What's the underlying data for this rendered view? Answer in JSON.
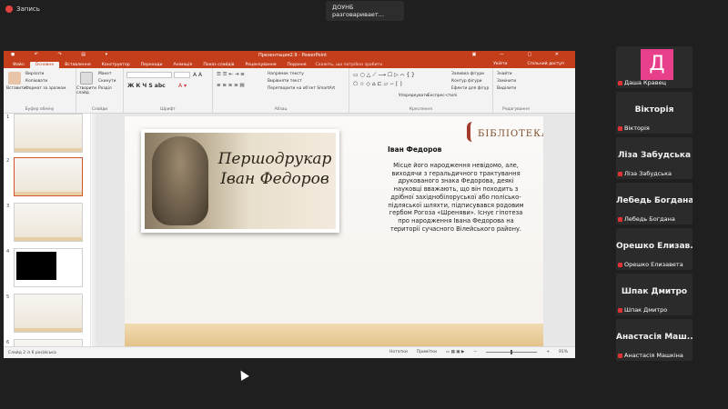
{
  "recording": {
    "label": "Запись"
  },
  "speaker": {
    "text": "ДОУНБ разговаривает..."
  },
  "ppt": {
    "title": "Презентация2.9 - PowerPoint",
    "tabs": [
      "Файл",
      "Основне",
      "Вставлення",
      "Конструктор",
      "Переходи",
      "Анімація",
      "Показ слайдів",
      "Рецензування",
      "Подання"
    ],
    "active_tab": "Основне",
    "search": "Скажіть, що потрібно зробити",
    "signin": "Увійти",
    "share": "Спільний доступ",
    "groups": {
      "clipboard": "Буфер обміну",
      "slides": "Слайди",
      "font": "Шрифт",
      "paragraph": "Абзац",
      "drawing": "Креслення",
      "editing": "Редагування"
    },
    "buttons": {
      "paste": "Вставити",
      "cut": "Вирізати",
      "copy": "Копіювати",
      "format": "Формат за зразком",
      "new_slide": "Створити слайд",
      "layout": "Макет",
      "reset": "Скинути",
      "section": "Розділ",
      "text_dir": "Напрямок тексту",
      "align_text": "Вирівняти текст",
      "smartart": "Перетворити на об'єкт SmartArt",
      "arrange": "Упорядкувати",
      "quick_styles": "Експрес-стилі",
      "fill": "Заливка фігури",
      "outline": "Контур фігури",
      "effects": "Ефекти для фігур",
      "find": "Знайти",
      "replace": "Замінити",
      "select": "Виділити"
    },
    "status": {
      "left": "Слайд 2 із 6   російська",
      "notes": "Нотатки",
      "comments": "Примітки",
      "zoom": "91%"
    },
    "slide": {
      "title_script": "Першодрукар Іван Федоров",
      "library": "БІБЛІОТЕКА",
      "name": "Іван Федоров",
      "body": "Місце його народження невідомо, але, виходячи з геральдичного трактування друкованого знака Федорова, деякі науковці вважають, що він походить з дрібної західнобілоруської або полісько-підляської шляхти, підписувався родовим гербом Рогоза «Шреняви». Існує гіпотеза про народження Івана Федорова на території сучасного Вілейського району."
    }
  },
  "participants": [
    {
      "name": "",
      "label": "Даша Кравец",
      "avatar": "Д"
    },
    {
      "name": "Вікторія",
      "label": "Вікторія"
    },
    {
      "name": "Ліза Забудська",
      "label": "Ліза Забудська"
    },
    {
      "name": "Лебедь Богдана",
      "label": "Лебедь Богдана"
    },
    {
      "name": "Орешко Елизав...",
      "label": "Орешко Елизавета"
    },
    {
      "name": "Шпак Дмитро",
      "label": "Шпак Дмитро"
    },
    {
      "name": "Анастасія Маш...",
      "label": "Анастасія Машкіна"
    }
  ]
}
